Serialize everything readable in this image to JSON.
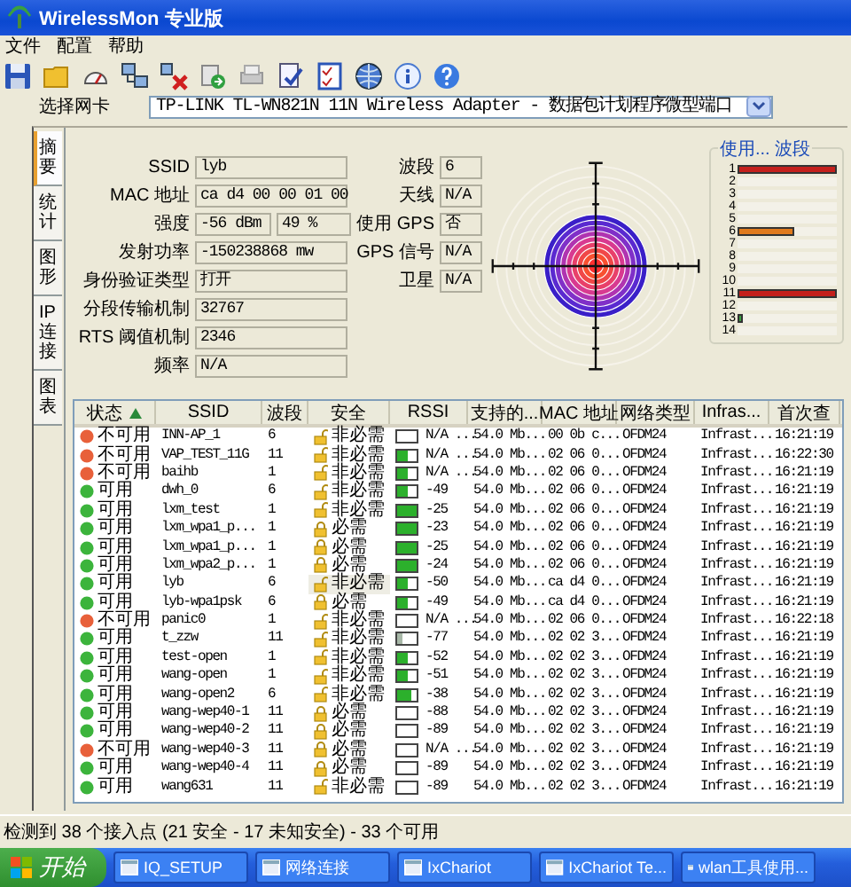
{
  "window": {
    "title": "WirelessMon 专业版"
  },
  "menu": [
    "文件",
    "配置",
    "帮助"
  ],
  "adapter": {
    "label": "选择网卡",
    "value": "TP-LINK TL-WN821N 11N Wireless Adapter - 数据包计划程序微型端口"
  },
  "side_tabs": [
    {
      "label": "摘要",
      "selected": true
    },
    {
      "label": "统计",
      "selected": false
    },
    {
      "label": "图形",
      "selected": false
    },
    {
      "label": "IP 连接",
      "selected": false
    },
    {
      "label": "图表",
      "selected": false
    }
  ],
  "summary": {
    "left": [
      {
        "label": "SSID",
        "values": [
          "lyb"
        ]
      },
      {
        "label": "MAC 地址",
        "values": [
          "ca d4 00 00 01 00"
        ]
      },
      {
        "label": "强度",
        "values": [
          "-56 dBm",
          "49 %"
        ]
      },
      {
        "label": "发射功率",
        "values": [
          "-150238868 mw"
        ]
      },
      {
        "label": "身份验证类型",
        "values": [
          "打开"
        ]
      },
      {
        "label": "分段传输机制",
        "values": [
          "32767"
        ]
      },
      {
        "label": "RTS 阈值机制",
        "values": [
          "2346"
        ]
      },
      {
        "label": "频率",
        "values": [
          "N/A"
        ]
      }
    ],
    "right": [
      {
        "label": "波段",
        "value": "6"
      },
      {
        "label": "天线",
        "value": "N/A"
      },
      {
        "label": "使用 GPS",
        "value": "否"
      },
      {
        "label": "GPS 信号",
        "value": "N/A"
      },
      {
        "label": "卫星",
        "value": "N/A"
      }
    ]
  },
  "channel_usage": {
    "title": "使用... 波段",
    "channels": [
      {
        "label": "1",
        "level": 1,
        "color": "#c4201c"
      },
      {
        "label": "2"
      },
      {
        "label": "3"
      },
      {
        "label": "4"
      },
      {
        "label": "5"
      },
      {
        "label": "6",
        "level": 0.58,
        "color": "#e07a1c"
      },
      {
        "label": "7"
      },
      {
        "label": "8"
      },
      {
        "label": "9"
      },
      {
        "label": "10"
      },
      {
        "label": "11",
        "level": 1,
        "color": "#c4201c"
      },
      {
        "label": "12"
      },
      {
        "label": "13",
        "level": 0.06,
        "color": "#3aa040"
      },
      {
        "label": "14"
      }
    ]
  },
  "table": {
    "columns": [
      "状态",
      "SSID",
      "波段",
      "安全",
      "RSSI",
      "支持的...",
      "MAC 地址",
      "网络类型",
      "Infras...",
      "首次查"
    ],
    "rows": [
      {
        "status": "不可用",
        "available": false,
        "ssid": "INN-AP_1",
        "band": "6",
        "security": "非必需",
        "encrypted": false,
        "rssi": "N/A ...",
        "rate": "54.0 Mb...",
        "mac": "00 0b c...",
        "net_type": "OFDM24",
        "infra": "Infrast...",
        "first_seen": "16:21:19",
        "selected": false
      },
      {
        "status": "不可用",
        "available": false,
        "ssid": "VAP_TEST_11G",
        "band": "11",
        "security": "非必需",
        "encrypted": false,
        "signal": {
          "level": 0.5
        },
        "rssi": "N/A ...",
        "rate": "54.0 Mb...",
        "mac": "02 06 0...",
        "net_type": "OFDM24",
        "infra": "Infrast...",
        "first_seen": "16:22:30",
        "selected": false
      },
      {
        "status": "不可用",
        "available": false,
        "ssid": "baihb",
        "band": "1",
        "security": "非必需",
        "encrypted": false,
        "signal": {
          "level": 0.5
        },
        "rssi": "N/A ...",
        "rate": "54.0 Mb...",
        "mac": "02 06 0...",
        "net_type": "OFDM24",
        "infra": "Infrast...",
        "first_seen": "16:21:19",
        "selected": false
      },
      {
        "status": "可用",
        "available": true,
        "ssid": "dwh_0",
        "band": "6",
        "security": "非必需",
        "encrypted": false,
        "signal": {
          "level": 0.5
        },
        "rssi": "-49",
        "rate": "54.0 Mb...",
        "mac": "02 06 0...",
        "net_type": "OFDM24",
        "infra": "Infrast...",
        "first_seen": "16:21:19",
        "selected": false
      },
      {
        "status": "可用",
        "available": true,
        "ssid": "lxm_test",
        "band": "1",
        "security": "非必需",
        "encrypted": false,
        "signal": {
          "level": 1
        },
        "rssi": "-25",
        "rate": "54.0 Mb...",
        "mac": "02 06 0...",
        "net_type": "OFDM24",
        "infra": "Infrast...",
        "first_seen": "16:21:19",
        "selected": false
      },
      {
        "status": "可用",
        "available": true,
        "ssid": "lxm_wpa1_p...",
        "band": "1",
        "security": "必需",
        "encrypted": true,
        "signal": {
          "level": 1
        },
        "rssi": "-23",
        "rate": "54.0 Mb...",
        "mac": "02 06 0...",
        "net_type": "OFDM24",
        "infra": "Infrast...",
        "first_seen": "16:21:19",
        "selected": false
      },
      {
        "status": "可用",
        "available": true,
        "ssid": "lxm_wpa1_p...",
        "band": "1",
        "security": "必需",
        "encrypted": true,
        "signal": {
          "level": 1
        },
        "rssi": "-25",
        "rate": "54.0 Mb...",
        "mac": "02 06 0...",
        "net_type": "OFDM24",
        "infra": "Infrast...",
        "first_seen": "16:21:19",
        "selected": false
      },
      {
        "status": "可用",
        "available": true,
        "ssid": "lxm_wpa2_p...",
        "band": "1",
        "security": "必需",
        "encrypted": true,
        "signal": {
          "level": 1
        },
        "rssi": "-24",
        "rate": "54.0 Mb...",
        "mac": "02 06 0...",
        "net_type": "OFDM24",
        "infra": "Infrast...",
        "first_seen": "16:21:19",
        "selected": false
      },
      {
        "status": "可用",
        "available": true,
        "ssid": "lyb",
        "band": "6",
        "security": "非必需",
        "encrypted": false,
        "signal": {
          "level": 0.5
        },
        "rssi": "-50",
        "rate": "54.0 Mb...",
        "mac": "ca d4 0...",
        "net_type": "OFDM24",
        "infra": "Infrast...",
        "first_seen": "16:21:19",
        "selected": true
      },
      {
        "status": "可用",
        "available": true,
        "ssid": "lyb-wpa1psk",
        "band": "6",
        "security": "必需",
        "encrypted": true,
        "signal": {
          "level": 0.5
        },
        "rssi": "-49",
        "rate": "54.0 Mb...",
        "mac": "ca d4 0...",
        "net_type": "OFDM24",
        "infra": "Infrast...",
        "first_seen": "16:21:19",
        "selected": false
      },
      {
        "status": "不可用",
        "available": false,
        "ssid": "panic0",
        "band": "1",
        "security": "非必需",
        "encrypted": false,
        "rssi": "N/A ...",
        "rate": "54.0 Mb...",
        "mac": "02 06 0...",
        "net_type": "OFDM24",
        "infra": "Infrast...",
        "first_seen": "16:22:18",
        "selected": false
      },
      {
        "status": "可用",
        "available": true,
        "ssid": "t_zzw",
        "band": "11",
        "security": "非必需",
        "encrypted": false,
        "signal": {
          "level": 0.25
        },
        "rssi": "-77",
        "rate": "54.0 Mb...",
        "mac": "02 02 3...",
        "net_type": "OFDM24",
        "infra": "Infrast...",
        "first_seen": "16:21:19",
        "selected": false
      },
      {
        "status": "可用",
        "available": true,
        "ssid": "test-open",
        "band": "1",
        "security": "非必需",
        "encrypted": false,
        "signal": {
          "level": 0.5
        },
        "rssi": "-52",
        "rate": "54.0 Mb...",
        "mac": "02 02 3...",
        "net_type": "OFDM24",
        "infra": "Infrast...",
        "first_seen": "16:21:19",
        "selected": false
      },
      {
        "status": "可用",
        "available": true,
        "ssid": "wang-open",
        "band": "1",
        "security": "非必需",
        "encrypted": false,
        "signal": {
          "level": 0.5
        },
        "rssi": "-51",
        "rate": "54.0 Mb...",
        "mac": "02 02 3...",
        "net_type": "OFDM24",
        "infra": "Infrast...",
        "first_seen": "16:21:19",
        "selected": false
      },
      {
        "status": "可用",
        "available": true,
        "ssid": "wang-open2",
        "band": "6",
        "security": "非必需",
        "encrypted": false,
        "signal": {
          "level": 0.75
        },
        "rssi": "-38",
        "rate": "54.0 Mb...",
        "mac": "02 02 3...",
        "net_type": "OFDM24",
        "infra": "Infrast...",
        "first_seen": "16:21:19",
        "selected": false
      },
      {
        "status": "可用",
        "available": true,
        "ssid": "wang-wep40-1",
        "band": "11",
        "security": "必需",
        "encrypted": true,
        "rssi": "-88",
        "rate": "54.0 Mb...",
        "mac": "02 02 3...",
        "net_type": "OFDM24",
        "infra": "Infrast...",
        "first_seen": "16:21:19",
        "selected": false
      },
      {
        "status": "可用",
        "available": true,
        "ssid": "wang-wep40-2",
        "band": "11",
        "security": "必需",
        "encrypted": true,
        "rssi": "-89",
        "rate": "54.0 Mb...",
        "mac": "02 02 3...",
        "net_type": "OFDM24",
        "infra": "Infrast...",
        "first_seen": "16:21:19",
        "selected": false
      },
      {
        "status": "不可用",
        "available": false,
        "ssid": "wang-wep40-3",
        "band": "11",
        "security": "必需",
        "encrypted": true,
        "rssi": "N/A ...",
        "rate": "54.0 Mb...",
        "mac": "02 02 3...",
        "net_type": "OFDM24",
        "infra": "Infrast...",
        "first_seen": "16:21:19",
        "selected": false
      },
      {
        "status": "可用",
        "available": true,
        "ssid": "wang-wep40-4",
        "band": "11",
        "security": "必需",
        "encrypted": true,
        "rssi": "-89",
        "rate": "54.0 Mb...",
        "mac": "02 02 3...",
        "net_type": "OFDM24",
        "infra": "Infrast...",
        "first_seen": "16:21:19",
        "selected": false
      },
      {
        "status": "可用",
        "available": true,
        "ssid": "wang631",
        "band": "11",
        "security": "非必需",
        "encrypted": false,
        "rssi": "-89",
        "rate": "54.0 Mb...",
        "mac": "02 02 3...",
        "net_type": "OFDM24",
        "infra": "Infrast...",
        "first_seen": "16:21:19",
        "selected": false
      }
    ]
  },
  "status_bar": "检测到 38 个接入点 (21 安全 - 17 未知安全) - 33 个可用",
  "taskbar": {
    "start": "开始",
    "items": [
      "IQ_SETUP",
      "网络连接",
      "IxChariot",
      "IxChariot Te...",
      "wlan工具使用..."
    ]
  }
}
